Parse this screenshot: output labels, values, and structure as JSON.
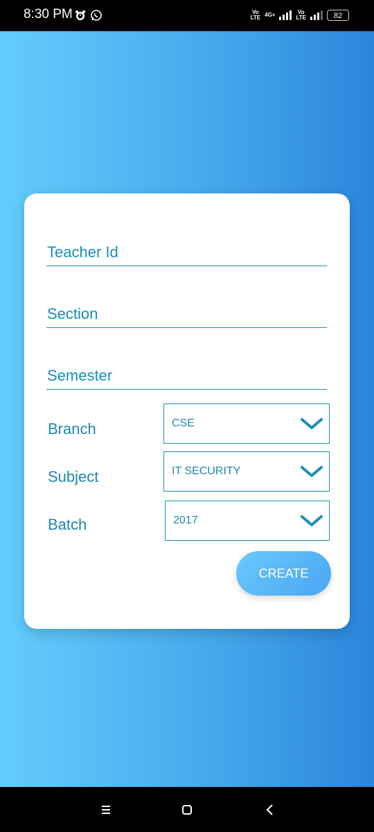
{
  "status_bar": {
    "time": "8:30 PM",
    "left_icons": [
      "alarm-icon",
      "whatsapp-icon"
    ],
    "sim1": {
      "top": "Vo​",
      "label": "VoLTE"
    },
    "network_type": "4G+",
    "battery": "82"
  },
  "form": {
    "teacher_id_placeholder": "Teacher Id",
    "section_placeholder": "Section",
    "semester_placeholder": "Semester",
    "branch_label": "Branch",
    "branch_value": "CSE",
    "subject_label": "Subject",
    "subject_value": "IT SECURITY",
    "batch_label": "Batch",
    "batch_value": "2017",
    "create_label": "CREATE"
  },
  "colors": {
    "accent": "#1a8fb4",
    "gradient_start": "#63cdfb",
    "gradient_end": "#2a86db",
    "button": "#4aa6f2"
  },
  "nav": [
    "menu-icon",
    "home-icon",
    "back-icon"
  ]
}
